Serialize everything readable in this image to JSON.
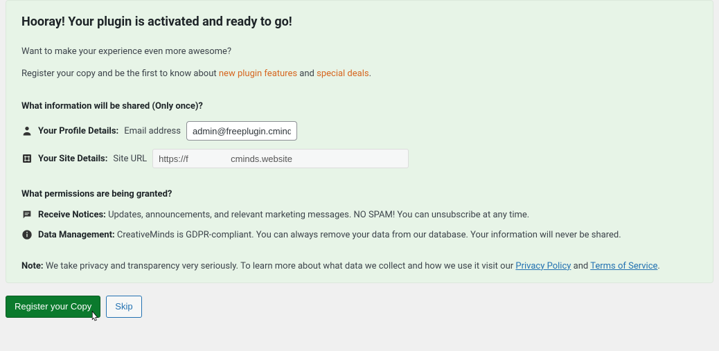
{
  "headline": "Hooray! Your plugin is activated and ready to go!",
  "intro": {
    "line1": "Want to make your experience even more awesome?",
    "line2_prefix": "Register your copy and be the first to know about ",
    "link_features": "new plugin features",
    "line2_mid": " and ",
    "link_deals": "special deals",
    "line2_suffix": "."
  },
  "shared": {
    "title": "What information will be shared (Only once)?",
    "profile_label": "Your Profile Details:",
    "email_label": "Email address",
    "email_value": "admin@freeplugin.cminds.website",
    "site_label": "Your Site Details:",
    "url_label": "Site URL",
    "url_value": "https://f                 cminds.website"
  },
  "permissions": {
    "title": "What permissions are being granted?",
    "notices_label": "Receive Notices:",
    "notices_text": "Updates, announcements, and relevant marketing messages. NO SPAM! You can unsubscribe at any time.",
    "data_label": "Data Management:",
    "data_text": "CreativeMinds is GDPR-compliant. You can always remove your data from our database. Your information will never be shared."
  },
  "note": {
    "label": "Note:",
    "text_prefix": " We take privacy and transparency very seriously. To learn more about what data we collect and how we use it visit our ",
    "privacy_link": "Privacy Policy",
    "text_mid": " and ",
    "terms_link": "Terms of Service",
    "text_suffix": "."
  },
  "actions": {
    "register": "Register your Copy",
    "skip": "Skip"
  }
}
